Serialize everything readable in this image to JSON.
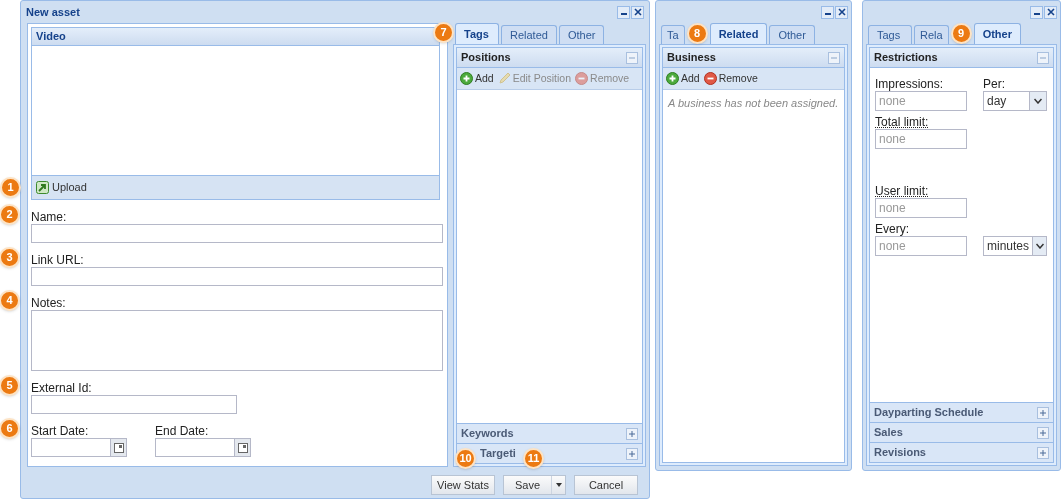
{
  "main_window": {
    "title": "New asset",
    "minimizable": true,
    "closable": true,
    "video_panel": {
      "title": "Video",
      "upload_button": "Upload",
      "callout": "1"
    },
    "fields": [
      {
        "kind": "text",
        "label": "Name:",
        "callout": "2"
      },
      {
        "kind": "text",
        "label": "Link URL:",
        "callout": "3"
      },
      {
        "kind": "textarea",
        "label": "Notes:",
        "callout": "4"
      },
      {
        "kind": "short",
        "label": "External Id:",
        "callout": "5"
      }
    ],
    "date_fields": {
      "callout": "6",
      "items": [
        {
          "label": "Start Date:"
        },
        {
          "label": "End Date:"
        }
      ]
    },
    "tab_panel": {
      "callout": "7",
      "tabs": [
        {
          "label": "Tags",
          "selected": true
        },
        {
          "label": "Related",
          "selected": false
        },
        {
          "label": "Other",
          "selected": false
        }
      ],
      "sections": [
        {
          "kind": "list",
          "title": "Positions",
          "expanded": true,
          "toolbar": [
            {
              "kind": "add",
              "label": "Add",
              "disabled": false
            },
            {
              "kind": "edit",
              "label": "Edit Position",
              "disabled": true
            },
            {
              "kind": "remove",
              "label": "Remove",
              "disabled": true
            }
          ]
        },
        {
          "title": "Keywords",
          "expanded": false
        },
        {
          "title": "Targeti",
          "expanded": false,
          "callouts": [
            "10",
            "11"
          ]
        }
      ]
    },
    "buttons": [
      {
        "kind": "plain",
        "label": "View Stats"
      },
      {
        "kind": "split",
        "label": "Save"
      },
      {
        "kind": "plain",
        "label": "Cancel"
      }
    ]
  },
  "related_window": {
    "minimizable": true,
    "closable": true,
    "tab_panel": {
      "tabs": [
        {
          "label": "Ta",
          "selected": false,
          "callout": "8"
        },
        {
          "label": "Related",
          "selected": true
        },
        {
          "label": "Other",
          "selected": false
        }
      ],
      "sections": [
        {
          "kind": "list",
          "title": "Business",
          "expanded": true,
          "toolbar": [
            {
              "kind": "add",
              "label": "Add",
              "disabled": false
            },
            {
              "kind": "remove",
              "label": "Remove",
              "disabled": false
            }
          ],
          "empty_text": "A business has not been assigned."
        }
      ]
    }
  },
  "other_window": {
    "minimizable": true,
    "closable": true,
    "tab_panel": {
      "tabs": [
        {
          "label": "Tags",
          "selected": false
        },
        {
          "label": "Rela",
          "selected": false,
          "callout": "9"
        },
        {
          "label": "Other",
          "selected": true
        }
      ],
      "sections": [
        {
          "kind": "form",
          "title": "Restrictions",
          "expanded": true,
          "rows": [
            [
              {
                "kind": "text",
                "label": "Impressions:",
                "placeholder": "none"
              },
              {
                "kind": "select",
                "label": "Per:",
                "value": "day"
              }
            ],
            [
              {
                "kind": "text",
                "label": "Total limit:",
                "placeholder": "none",
                "tooltip": true
              }
            ],
            [
              {
                "kind": "text",
                "label": "User limit:",
                "placeholder": "none",
                "tooltip": true
              }
            ],
            [
              {
                "kind": "text",
                "label": "Every:",
                "placeholder": "none"
              },
              {
                "kind": "select",
                "value": "minutes"
              }
            ]
          ]
        },
        {
          "title": "Dayparting Schedule",
          "expanded": false
        },
        {
          "title": "Sales",
          "expanded": false
        },
        {
          "title": "Revisions",
          "expanded": false
        }
      ]
    }
  }
}
